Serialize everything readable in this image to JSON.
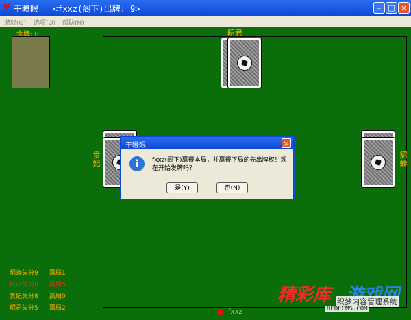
{
  "titlebar": {
    "app_name": "干瞪眼",
    "status": "<fxxz(阁下)出牌: 9>"
  },
  "menu": {
    "items": [
      "游戏(G)",
      "选项(O)",
      "帮助(H)"
    ]
  },
  "table": {
    "remaining_label": "余牌: 0",
    "top_player": "昭君",
    "left_player": "贵妃",
    "right_player": "貂蝉",
    "me": "fxxz"
  },
  "dialog": {
    "title": "干瞪眼",
    "message": "fxxz(阁下)赢得本局，并赢得下局的先出牌权！现在开始发牌吗？",
    "yes_label": "是(Y)",
    "no_label": "否(N)"
  },
  "scores": [
    {
      "text": "貂蝉失分9",
      "wins": "赢局1",
      "color": "#ffb000"
    },
    {
      "text": "fxxz失分0",
      "wins": "赢局5",
      "color": "#e03a1a"
    },
    {
      "text": "贵妃失分8",
      "wins": "赢局0",
      "color": "#ffb000"
    },
    {
      "text": "昭君失分5",
      "wins": "赢局2",
      "color": "#ffb000"
    }
  ],
  "watermark": {
    "line1a": "精彩库",
    "line1b": "游戏网",
    "line2": "织梦内容管理系统",
    "line3": "DEDECMS.COM"
  },
  "colors": {
    "felt": "#0a6f0a",
    "accent": "#ffb000"
  }
}
